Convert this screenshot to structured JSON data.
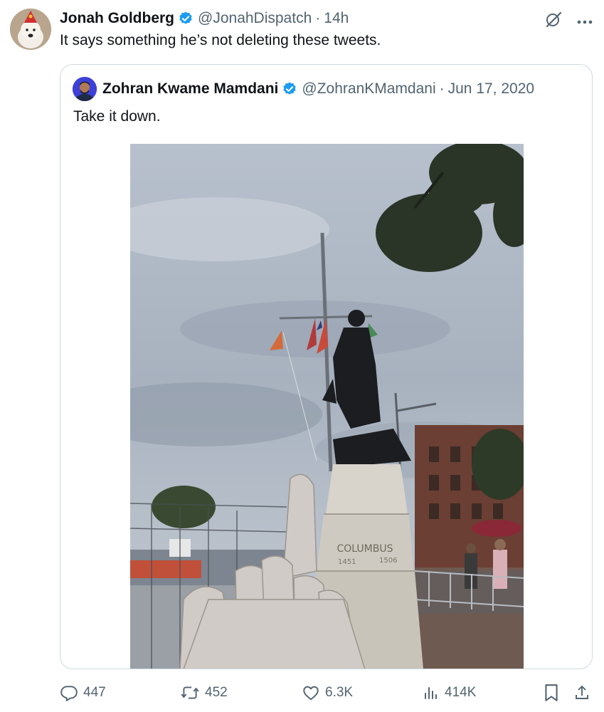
{
  "tweet": {
    "author_name": "Jonah Goldberg",
    "author_handle": "@JonahDispatch",
    "separator": "·",
    "time": "14h",
    "text": "It says something he’s not deleting these tweets."
  },
  "quoted": {
    "author_name": "Zohran Kwame Mamdani",
    "author_handle": "@ZohranKMamdani",
    "separator": "·",
    "date": "Jun 17, 2020",
    "text": "Take it down.",
    "photo": {
      "statue_inscription": "COLUMBUS",
      "years_left": "1451",
      "years_right": "1506"
    }
  },
  "actions": {
    "replies": "447",
    "reposts": "452",
    "likes": "6.3K",
    "views": "414K"
  },
  "icons": [
    "verified-badge-icon",
    "grok-icon",
    "more-icon",
    "reply-icon",
    "repost-icon",
    "like-icon",
    "views-icon",
    "bookmark-icon",
    "share-icon"
  ],
  "colors": {
    "verified": "#1d9bf0",
    "text": "#0f1419",
    "secondary": "#536471",
    "border": "#cfd9de"
  }
}
